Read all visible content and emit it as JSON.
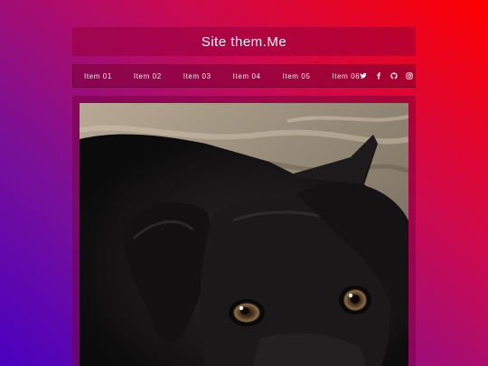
{
  "header": {
    "title": "Site them.Me"
  },
  "nav": {
    "items": [
      {
        "label": "Item 01"
      },
      {
        "label": "Item 02"
      },
      {
        "label": "Item 03"
      },
      {
        "label": "Item 04"
      },
      {
        "label": "Item 05"
      },
      {
        "label": "Item 06"
      }
    ],
    "social": [
      {
        "icon": "twitter-icon"
      },
      {
        "icon": "facebook-icon"
      },
      {
        "icon": "github-icon"
      },
      {
        "icon": "instagram-icon"
      }
    ]
  },
  "main": {
    "image": {
      "subject": "black puppy"
    }
  },
  "colors": {
    "gradient_start": "#4a00c0",
    "gradient_end": "#ff0000",
    "header_bg": "#96003c",
    "nav_text": "#f3e6ee"
  }
}
